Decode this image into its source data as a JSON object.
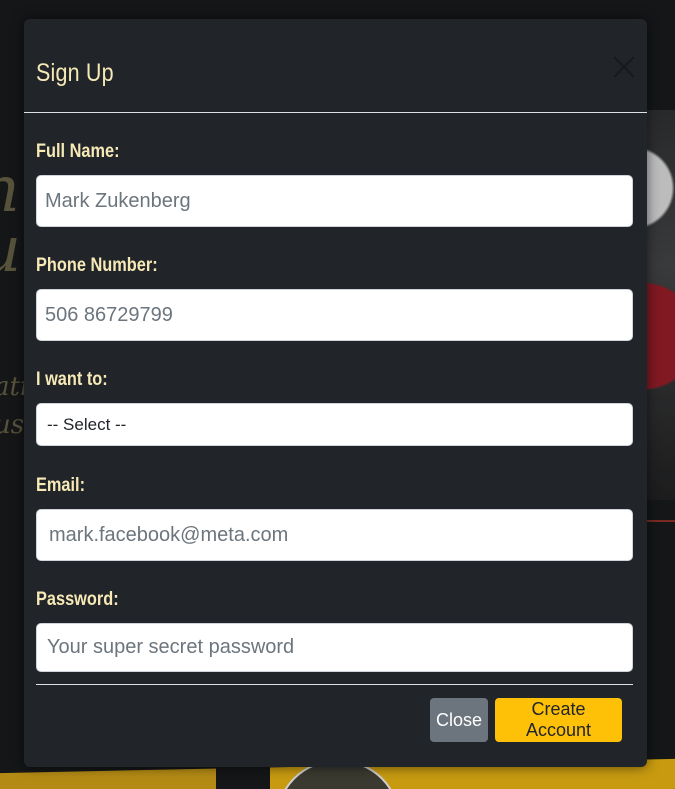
{
  "modal": {
    "title": "Sign Up",
    "close_icon": "close-icon"
  },
  "form": {
    "full_name": {
      "label": "Full Name:",
      "value": "Mark Zukenberg"
    },
    "phone": {
      "label": "Phone Number:",
      "value": "506 86729799"
    },
    "intent": {
      "label": "I want to:",
      "selected": "-- Select --"
    },
    "email": {
      "label": "Email:",
      "value": "mark.facebook@meta.com"
    },
    "password": {
      "label": "Password:",
      "placeholder": "Your super secret password"
    }
  },
  "footer": {
    "close_label": "Close",
    "create_label": "Create Account"
  },
  "colors": {
    "modal_bg": "#212529",
    "label_text": "#f6e9b6",
    "primary_button": "#ffc107",
    "secondary_button": "#6c757d"
  }
}
